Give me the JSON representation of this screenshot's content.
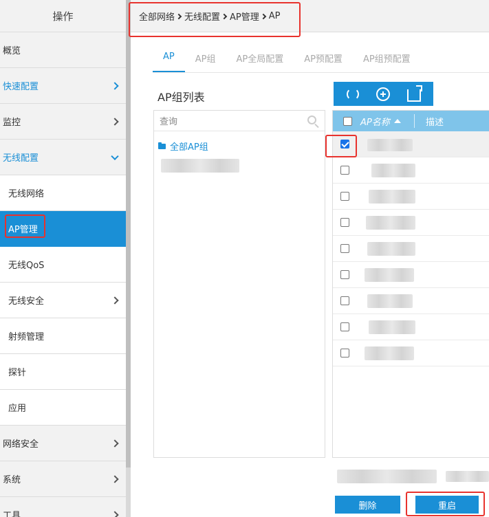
{
  "sidebar": {
    "header": "操作",
    "items": [
      {
        "label": "概览"
      },
      {
        "label": "快速配置"
      },
      {
        "label": "监控"
      },
      {
        "label": "无线配置"
      },
      {
        "label": "无线网络"
      },
      {
        "label": "AP管理"
      },
      {
        "label": "无线QoS"
      },
      {
        "label": "无线安全"
      },
      {
        "label": "射频管理"
      },
      {
        "label": "探针"
      },
      {
        "label": "应用"
      },
      {
        "label": "网络安全"
      },
      {
        "label": "系统"
      },
      {
        "label": "工具"
      }
    ]
  },
  "breadcrumb": [
    "全部网络",
    "无线配置",
    "AP管理",
    "AP"
  ],
  "tabs": [
    {
      "label": "AP"
    },
    {
      "label": "AP组"
    },
    {
      "label": "AP全局配置"
    },
    {
      "label": "AP预配置"
    },
    {
      "label": "AP组预配置"
    }
  ],
  "group_panel": {
    "title": "AP组列表",
    "search_placeholder": "查询",
    "root_label": "全部AP组"
  },
  "ap_table": {
    "columns": [
      "AP名称",
      "描述"
    ],
    "rows": [
      {
        "checked": true
      },
      {
        "checked": false
      },
      {
        "checked": false
      },
      {
        "checked": false
      },
      {
        "checked": false
      },
      {
        "checked": false
      },
      {
        "checked": false
      },
      {
        "checked": false
      },
      {
        "checked": false
      }
    ]
  },
  "buttons": {
    "delete": "删除",
    "restart": "重启"
  },
  "colors": {
    "accent": "#1a8fd6",
    "table_header": "#7fc4ea",
    "highlight": "#e8322d"
  }
}
